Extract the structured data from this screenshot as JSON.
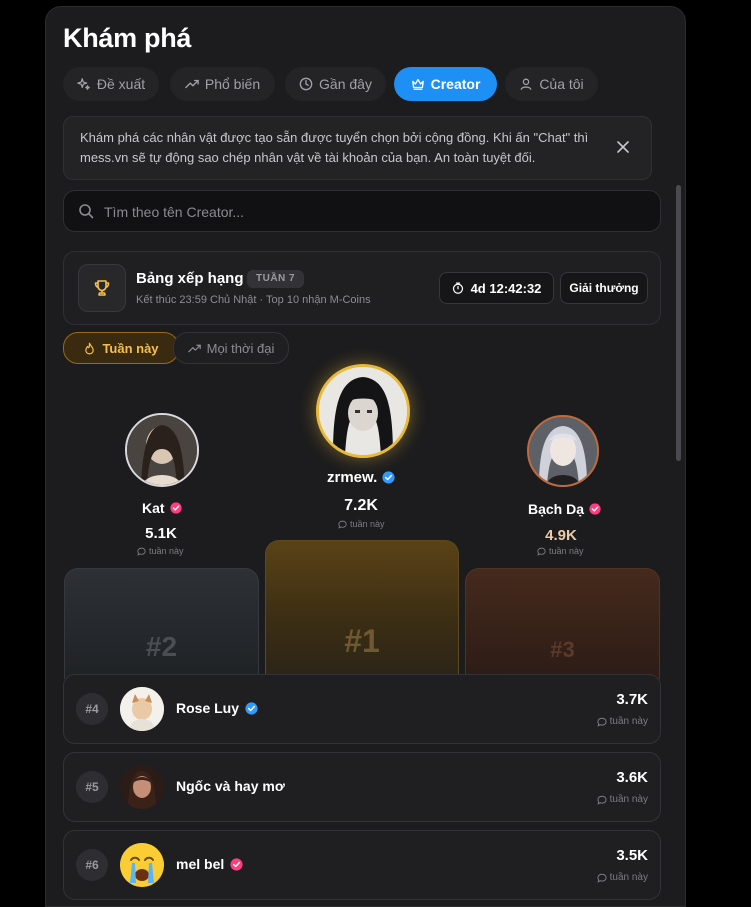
{
  "title": "Khám phá",
  "tabs": [
    {
      "label": "Đề xuất",
      "icon": "sparkles-icon",
      "active": false
    },
    {
      "label": "Phổ biến",
      "icon": "trending-icon",
      "active": false
    },
    {
      "label": "Gần đây",
      "icon": "clock-icon",
      "active": false
    },
    {
      "label": "Creator",
      "icon": "crown-icon",
      "active": true
    },
    {
      "label": "Của tôi",
      "icon": "user-icon",
      "active": false
    }
  ],
  "notice": {
    "text": "Khám phá các nhân vật được tạo sẵn được tuyển chọn bởi cộng đồng. Khi ấn \"Chat\" thì mess.vn sẽ tự động sao chép nhân vật về tài khoản của bạn. An toàn tuyệt đối."
  },
  "search": {
    "placeholder": "Tìm theo tên Creator..."
  },
  "ranking": {
    "title": "Bảng xếp hạng",
    "week_badge": "TUẦN 7",
    "subtitle": "Kết thúc 23:59 Chủ Nhật · Top 10 nhận M-Coins",
    "timer": "4d 12:42:32",
    "reward_label": "Giải thưởng"
  },
  "filters": {
    "this_week": "Tuần này",
    "all_time": "Mọi thời đại"
  },
  "podium": {
    "first": {
      "name": "zrmew.",
      "score": "7.2K",
      "period": "tuần này",
      "rank_label": "#1",
      "verified": "blue"
    },
    "second": {
      "name": "Kat",
      "score": "5.1K",
      "period": "tuần này",
      "rank_label": "#2",
      "verified": "pink"
    },
    "third": {
      "name": "Bạch Dạ",
      "score": "4.9K",
      "period": "tuần này",
      "rank_label": "#3",
      "verified": "pink"
    }
  },
  "list": [
    {
      "rank": "#4",
      "name": "Rose Luy",
      "score": "3.7K",
      "period": "tuần này",
      "verified": "blue"
    },
    {
      "rank": "#5",
      "name": "Ngốc và hay mơ",
      "score": "3.6K",
      "period": "tuần này",
      "verified": "none"
    },
    {
      "rank": "#6",
      "name": "mel bel",
      "score": "3.5K",
      "period": "tuần này",
      "verified": "pink"
    }
  ],
  "colors": {
    "accent": "#1e8ff5",
    "gold": "#f5c04a",
    "verified_blue": "#2f9bff",
    "verified_pink": "#ff3d7f"
  }
}
